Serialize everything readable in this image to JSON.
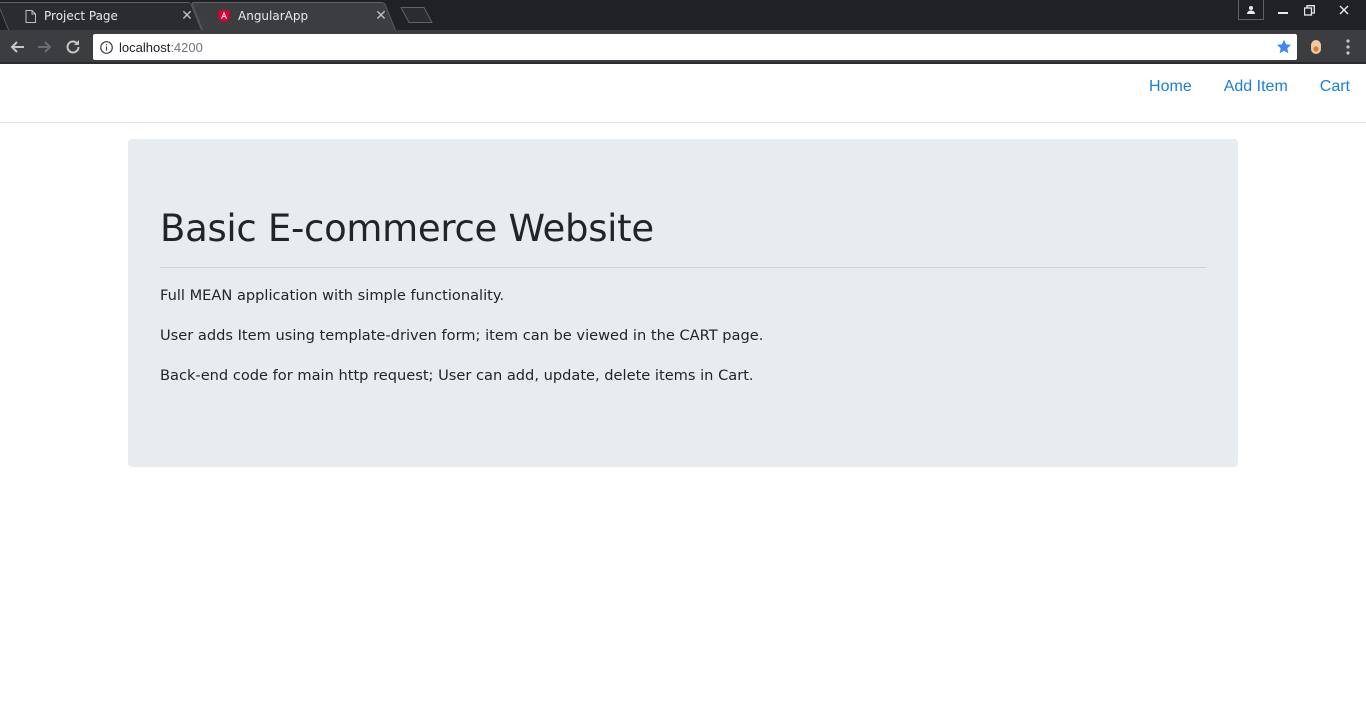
{
  "browser": {
    "tabs": [
      {
        "title": "Project Page",
        "icon": "page-icon",
        "active": false
      },
      {
        "title": "AngularApp",
        "icon": "angular-icon",
        "active": true
      }
    ],
    "url_host": "localhost",
    "url_port": ":4200",
    "window_controls": [
      "user-icon",
      "minimize-icon",
      "restore-icon",
      "close-icon"
    ],
    "colors": {
      "chrome_dark": "#202124",
      "toolbar": "#3c3d40",
      "star": "#4285f4",
      "angular_red": "#dd0031"
    }
  },
  "navbar": {
    "links": [
      "Home",
      "Add Item",
      "Cart"
    ],
    "link_color": "#1a7fd8"
  },
  "jumbotron": {
    "title": "Basic E-commerce Website",
    "paragraphs": [
      "Full MEAN application with simple functionality.",
      "User adds Item using template-driven form; item can be viewed in the CART page.",
      "Back-end code for main http request; User can add, update, delete items in Cart."
    ],
    "background": "#e9ecef"
  }
}
